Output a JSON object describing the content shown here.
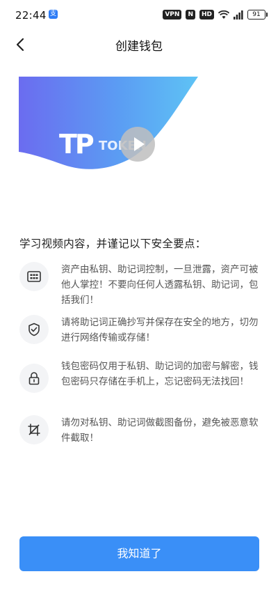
{
  "status_bar": {
    "time": "22:44",
    "app_icon": "alipay-icon",
    "indicators": [
      "VPN",
      "N",
      "HD"
    ],
    "battery": "91"
  },
  "nav": {
    "title": "创建钱包",
    "back_icon": "chevron-left-icon"
  },
  "video": {
    "logo_mark": "TP",
    "brand_text": "TOKEN POCKET",
    "play_icon": "play-icon"
  },
  "intro": "学习视频内容，并谨记以下安全要点：",
  "tips": [
    {
      "icon": "keypad-icon",
      "text": "资产由私钥、助记词控制，一旦泄露，资产可被他人掌控！不要向任何人透露私钥、助记词，包括我们！"
    },
    {
      "icon": "shield-check-icon",
      "text": "请将助记词正确抄写并保存在安全的地方，切勿进行网络传输或存储！"
    },
    {
      "icon": "lock-icon",
      "text": "钱包密码仅用于私钥、助记词的加密与解密，钱包密码只存储在手机上，忘记密码无法找回！"
    },
    {
      "icon": "crop-icon",
      "text": "请勿对私钥、助记词做截图备份，避免被恶意软件截取！"
    }
  ],
  "button_label": "我知道了",
  "colors": {
    "accent": "#3a8ff7",
    "banner_start": "#6b6cf0",
    "banner_end": "#5ec3f5"
  }
}
